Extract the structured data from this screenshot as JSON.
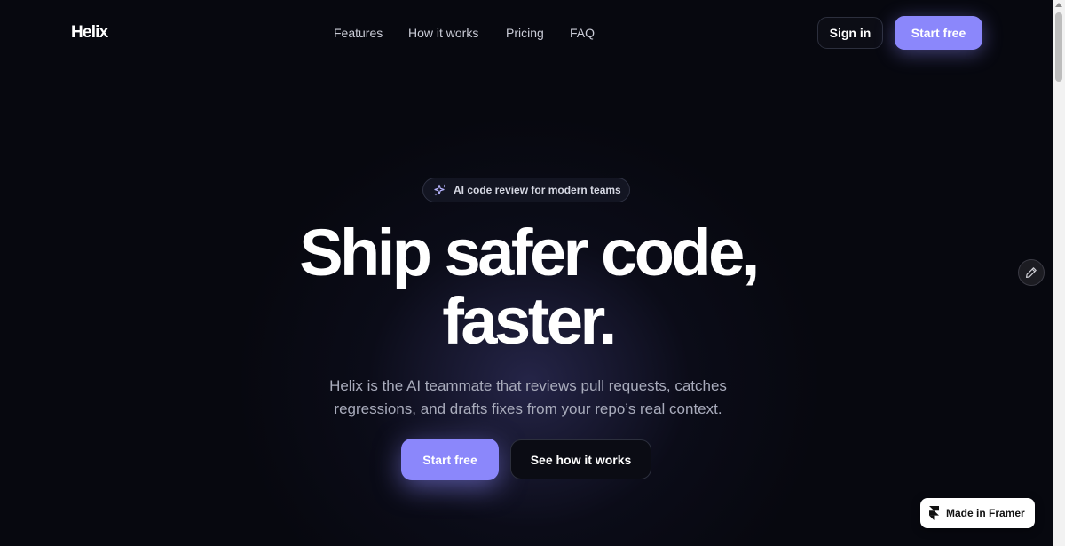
{
  "header": {
    "logo": "Helix",
    "nav": [
      {
        "label": "Features"
      },
      {
        "label": "How it works"
      },
      {
        "label": "Pricing"
      },
      {
        "label": "FAQ"
      }
    ],
    "sign_in_label": "Sign in",
    "start_free_label": "Start free"
  },
  "hero": {
    "badge_text": "AI code review for modern teams",
    "badge_icon": "sparkles-icon",
    "headline_line1": "Ship safer code,",
    "headline_line2": "faster.",
    "subtitle_line1": "Helix is the AI teammate that reviews pull requests, catches",
    "subtitle_line2": "regressions, and drafts fixes from your repo’s real context.",
    "primary_cta": "Start free",
    "secondary_cta": "See how it works"
  },
  "overlay": {
    "edit_icon": "pencil-icon",
    "framer_badge": "Made in Framer"
  },
  "colors": {
    "background": "#07080f",
    "accent": "#8b87fb",
    "text_muted": "#a8abbb"
  }
}
